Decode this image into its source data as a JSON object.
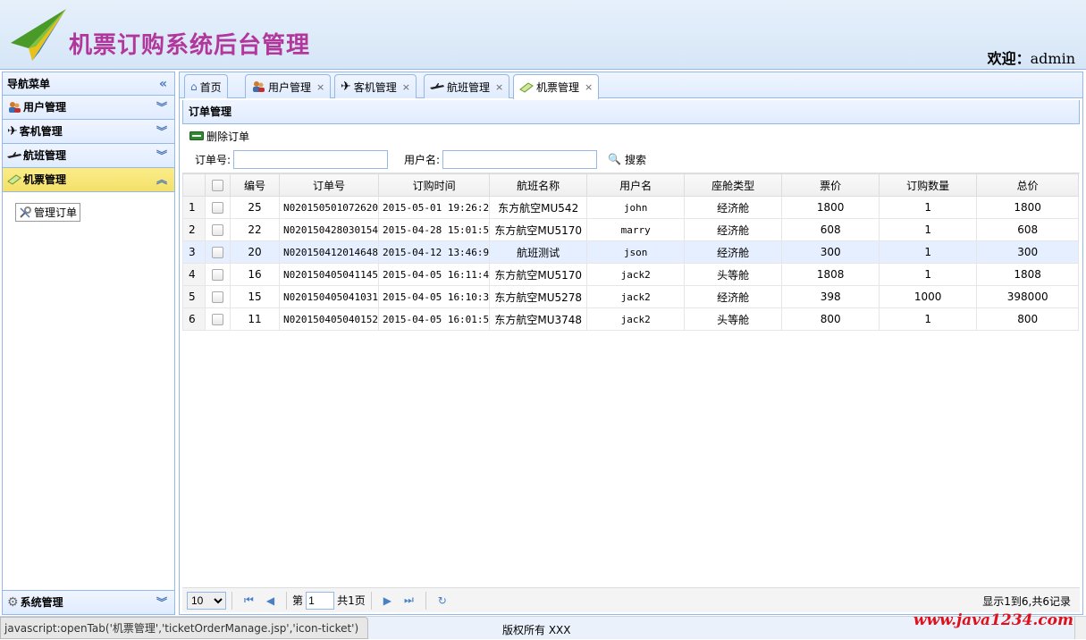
{
  "header": {
    "title": "机票订购系统后台管理",
    "welcome_label": "欢迎：",
    "username": "admin"
  },
  "sidebar": {
    "title": "导航菜单",
    "sections": [
      {
        "label": "用户管理",
        "icon": "users-icon"
      },
      {
        "label": "客机管理",
        "icon": "airplane-icon"
      },
      {
        "label": "航班管理",
        "icon": "flight-icon"
      },
      {
        "label": "机票管理",
        "icon": "ticket-icon"
      }
    ],
    "sub_item": "管理订单",
    "bottom_section": "系统管理"
  },
  "tabs": [
    {
      "label": "首页"
    },
    {
      "label": "用户管理"
    },
    {
      "label": "客机管理"
    },
    {
      "label": "航班管理"
    },
    {
      "label": "机票管理"
    }
  ],
  "panel": {
    "title": "订单管理"
  },
  "toolbar": {
    "delete_label": "删除订单"
  },
  "search": {
    "order_no_label": "订单号:",
    "username_label": "用户名:",
    "search_label": "搜索",
    "order_no_value": "",
    "username_value": ""
  },
  "table": {
    "columns": [
      "编号",
      "订单号",
      "订购时间",
      "航班名称",
      "用户名",
      "座舱类型",
      "票价",
      "订购数量",
      "总价"
    ],
    "rows": [
      {
        "rn": "1",
        "id": "25",
        "order_no": "N020150501072620",
        "time": "2015-05-01 19:26:2",
        "flight": "东方航空MU542",
        "user": "john",
        "cabin": "经济舱",
        "price": "1800",
        "qty": "1",
        "total": "1800"
      },
      {
        "rn": "2",
        "id": "22",
        "order_no": "N020150428030154",
        "time": "2015-04-28 15:01:5",
        "flight": "东方航空MU5170",
        "user": "marry",
        "cabin": "经济舱",
        "price": "608",
        "qty": "1",
        "total": "608"
      },
      {
        "rn": "3",
        "id": "20",
        "order_no": "N020150412014648",
        "time": "2015-04-12 13:46:9",
        "flight": "航班测试",
        "user": "json",
        "cabin": "经济舱",
        "price": "300",
        "qty": "1",
        "total": "300"
      },
      {
        "rn": "4",
        "id": "16",
        "order_no": "N020150405041145",
        "time": "2015-04-05 16:11:4",
        "flight": "东方航空MU5170",
        "user": "jack2",
        "cabin": "头等舱",
        "price": "1808",
        "qty": "1",
        "total": "1808"
      },
      {
        "rn": "5",
        "id": "15",
        "order_no": "N020150405041031",
        "time": "2015-04-05 16:10:3",
        "flight": "东方航空MU5278",
        "user": "jack2",
        "cabin": "经济舱",
        "price": "398",
        "qty": "1000",
        "total": "398000"
      },
      {
        "rn": "6",
        "id": "11",
        "order_no": "N020150405040152",
        "time": "2015-04-05 16:01:5",
        "flight": "东方航空MU3748",
        "user": "jack2",
        "cabin": "头等舱",
        "price": "800",
        "qty": "1",
        "total": "800"
      }
    ]
  },
  "pager": {
    "page_size": "10",
    "page_prefix": "第",
    "page_value": "1",
    "page_total": "共1页",
    "info": "显示1到6,共6记录"
  },
  "footer": {
    "status": "javascript:openTab('机票管理','ticketOrderManage.jsp','icon-ticket')",
    "copyright": "版权所有 XXX",
    "watermark": "www.java1234.com"
  },
  "colors": {
    "border": "#95b8e7",
    "title": "#b1379c",
    "selected_section": "#f4e06a",
    "highlight_row": "#e6efff",
    "watermark": "#e0101a"
  }
}
